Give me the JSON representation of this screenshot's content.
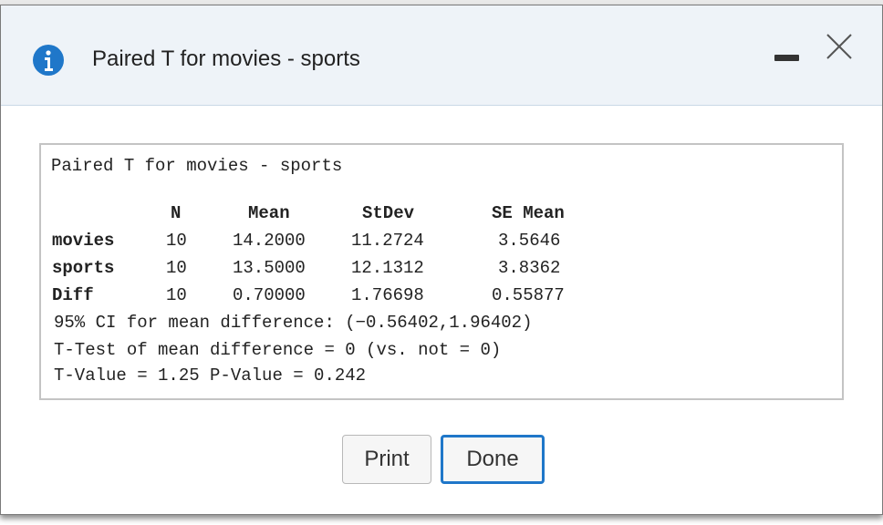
{
  "dialog": {
    "title": "Paired T for movies - sports",
    "icon": "info-icon",
    "accent": "#1f77c9"
  },
  "output": {
    "title": "Paired T for movies - sports",
    "headers": {
      "n": "N",
      "mean": "Mean",
      "stdev": "StDev",
      "se_mean": "SE Mean"
    },
    "rows": [
      {
        "label": "movies",
        "n": "10",
        "mean": "14.2000",
        "stdev": "11.2724",
        "se_mean": "3.5646"
      },
      {
        "label": "sports",
        "n": "10",
        "mean": "13.5000",
        "stdev": "12.1312",
        "se_mean": "3.8362"
      },
      {
        "label": "Diff",
        "n": "10",
        "mean": "0.70000",
        "stdev": "1.76698",
        "se_mean": "0.55877"
      }
    ],
    "ci_line": "95% CI for mean difference: (−0.56402,1.96402)",
    "ttest_line": "T-Test of mean difference = 0 (vs. not = 0)",
    "tvalue_line": "T-Value = 1.25 P-Value = 0.242"
  },
  "buttons": {
    "print": "Print",
    "done": "Done"
  }
}
